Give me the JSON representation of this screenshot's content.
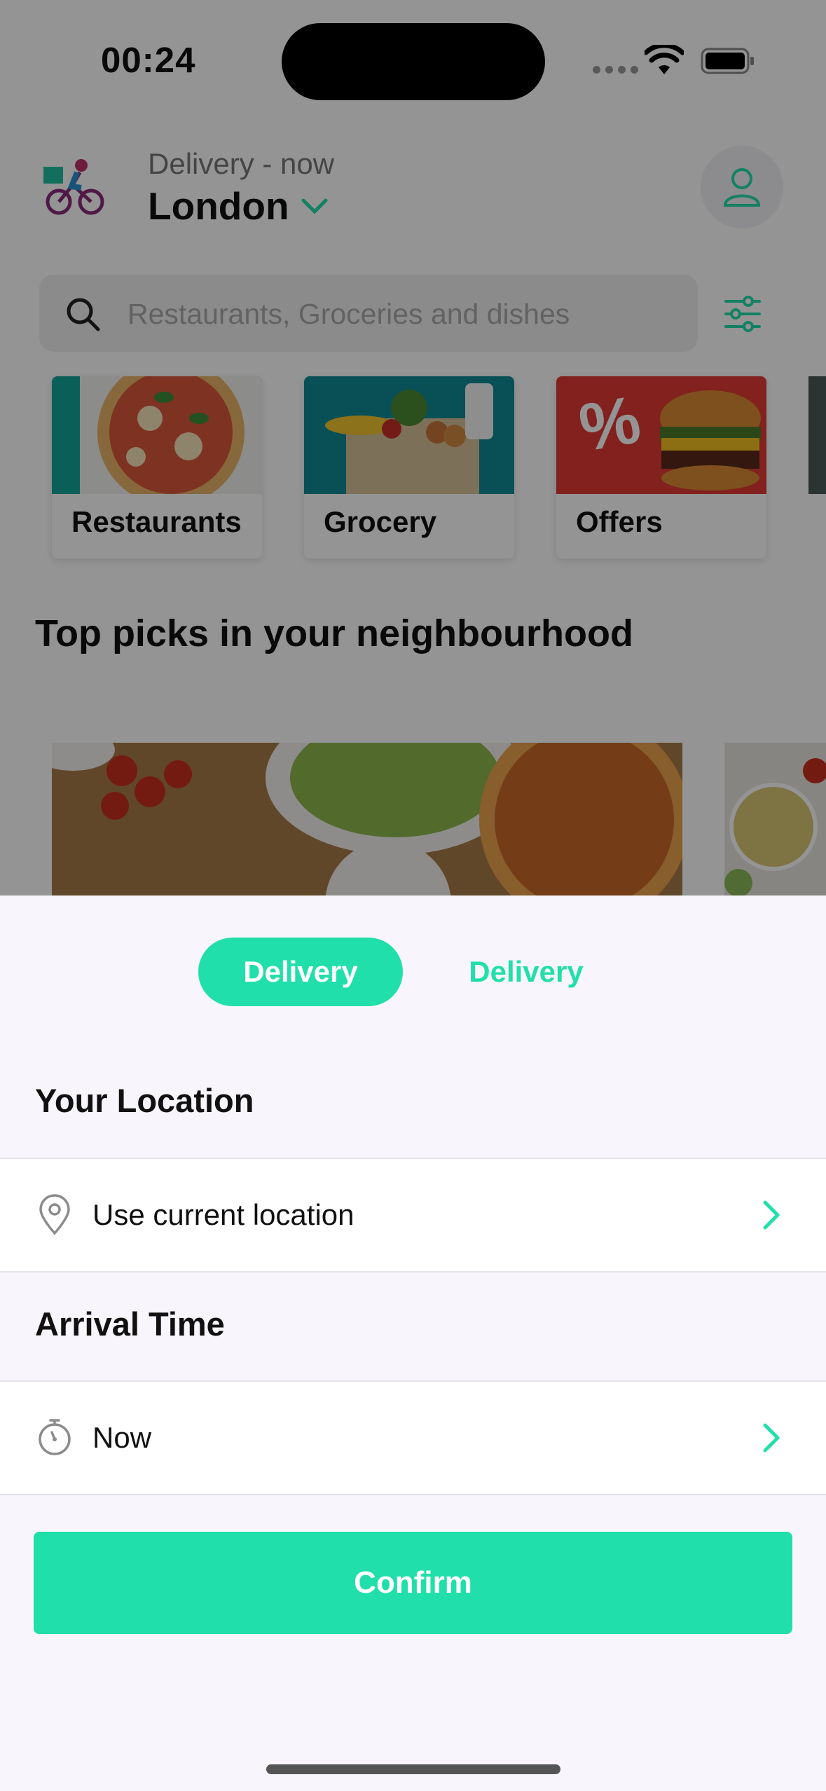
{
  "status_bar": {
    "time": "00:24"
  },
  "header": {
    "delivery_label": "Delivery - now",
    "city": "London"
  },
  "search": {
    "placeholder": "Restaurants, Groceries and dishes"
  },
  "categories": [
    {
      "label": "Restaurants"
    },
    {
      "label": "Grocery"
    },
    {
      "label": "Offers"
    }
  ],
  "section_title": "Top picks in your neighbourhood",
  "sheet": {
    "tabs": [
      {
        "label": "Delivery",
        "active": true
      },
      {
        "label": "Delivery",
        "active": false
      }
    ],
    "location_heading": "Your Location",
    "location_value": "Use current location",
    "time_heading": "Arrival Time",
    "time_value": "Now",
    "confirm_label": "Confirm"
  },
  "colors": {
    "accent": "#21dfaa",
    "sheet_bg": "#f8f6fc"
  }
}
